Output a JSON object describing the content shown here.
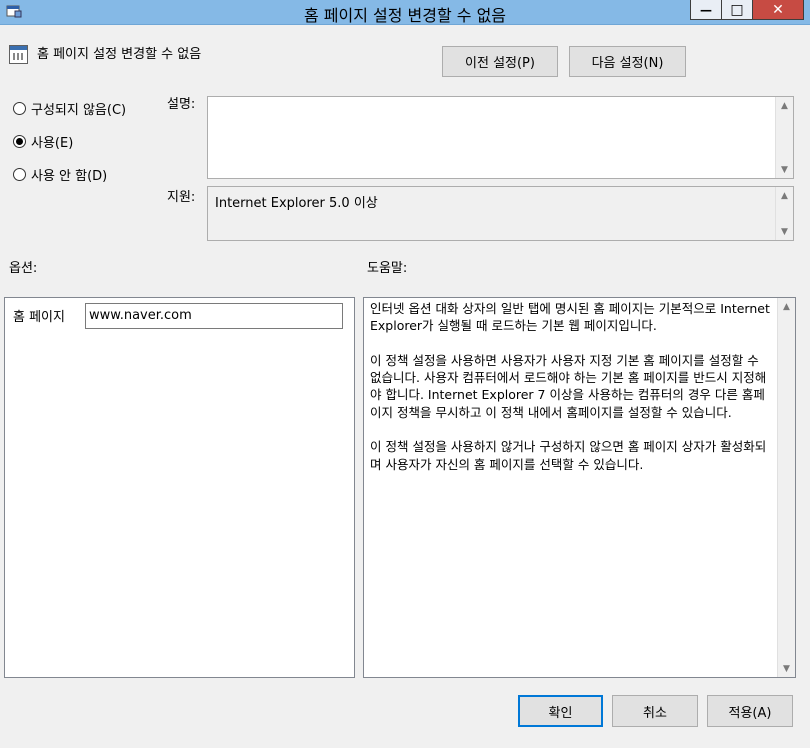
{
  "window": {
    "title": "홈 페이지 설정 변경할 수 없음",
    "minimize": "—",
    "maximize": "□",
    "close": "✕"
  },
  "header": {
    "policy_name": "홈 페이지 설정 변경할 수 없음",
    "prev_button": "이전 설정(P)",
    "next_button": "다음 설정(N)"
  },
  "state": {
    "options": [
      {
        "label": "구성되지 않음(C)",
        "selected": false
      },
      {
        "label": "사용(E)",
        "selected": true
      },
      {
        "label": "사용 안 함(D)",
        "selected": false
      }
    ]
  },
  "comment": {
    "label": "설명:",
    "value": ""
  },
  "supported": {
    "label": "지원:",
    "value": "Internet Explorer 5.0 이상"
  },
  "options_pane": {
    "label": "옵션:",
    "field_label": "홈 페이지",
    "field_value": "www.naver.com"
  },
  "help_pane": {
    "label": "도움말:",
    "text": "인터넷 옵션 대화 상자의 일반 탭에 명시된 홈 페이지는 기본적으로 Internet Explorer가 실행될 때 로드하는 기본 웹 페이지입니다.\n\n이 정책 설정을 사용하면 사용자가 사용자 지정 기본 홈 페이지를 설정할 수 없습니다. 사용자 컴퓨터에서 로드해야 하는 기본 홈 페이지를 반드시 지정해야 합니다. Internet Explorer 7 이상을 사용하는 컴퓨터의 경우 다른 홈페이지 정책을 무시하고 이 정책 내에서 홈페이지를 설정할 수 있습니다.\n\n이 정책 설정을 사용하지 않거나 구성하지 않으면 홈 페이지 상자가 활성화되며 사용자가 자신의 홈 페이지를 선택할 수 있습니다."
  },
  "footer": {
    "ok": "확인",
    "cancel": "취소",
    "apply": "적용(A)"
  },
  "colors": {
    "titlebar": "#85b9e6",
    "close_button": "#c74b43",
    "default_button_border": "#0078d7"
  }
}
